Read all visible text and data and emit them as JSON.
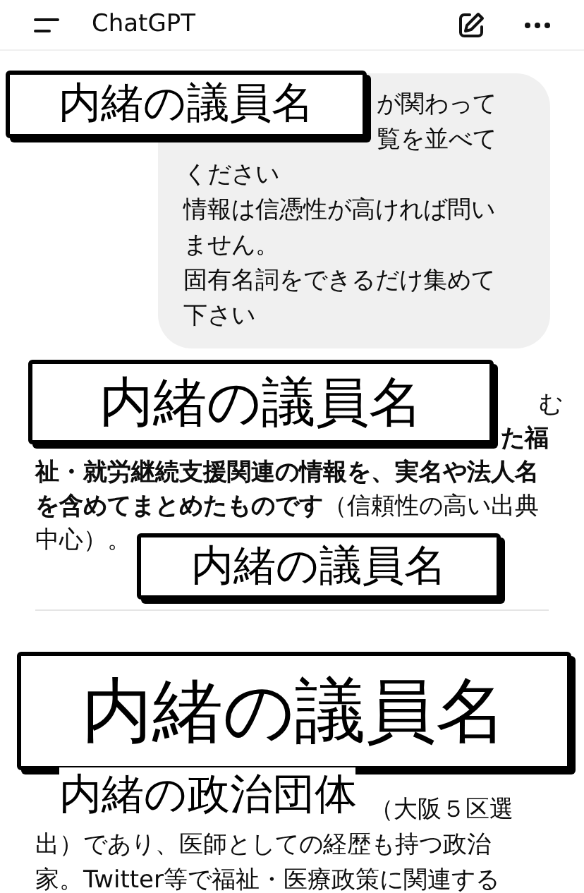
{
  "header": {
    "title": "ChatGPT"
  },
  "user_message": {
    "lines": [
      "が関わって",
      "覧を並べて",
      "ください",
      "情報は信憑性が高ければ問い",
      "ません。",
      "固有名詞をできるだけ集めて",
      "下さい"
    ]
  },
  "answer_intro": {
    "lines": [
      "む",
      "**た福**",
      "**祉・就労継続支援関連の情報を、実名や法人名**",
      "**を含めてまとめたものです**（信頼性の高い出典",
      "中心）。"
    ]
  },
  "answer_item": {
    "lines": [
      "（大阪５区選",
      "出）であり、医師としての経歴も持つ政治",
      "家。Twitter等で福祉・医療政策に関連する"
    ]
  },
  "stickers": [
    {
      "kind": "boxed",
      "text": "内緒の議員名"
    },
    {
      "kind": "boxed",
      "text": "内緒の議員名"
    },
    {
      "kind": "boxed",
      "text": "内緒の議員名"
    },
    {
      "kind": "boxed",
      "text": "内緒の議員名"
    },
    {
      "kind": "plain",
      "text": "内緒の政治団体"
    }
  ]
}
